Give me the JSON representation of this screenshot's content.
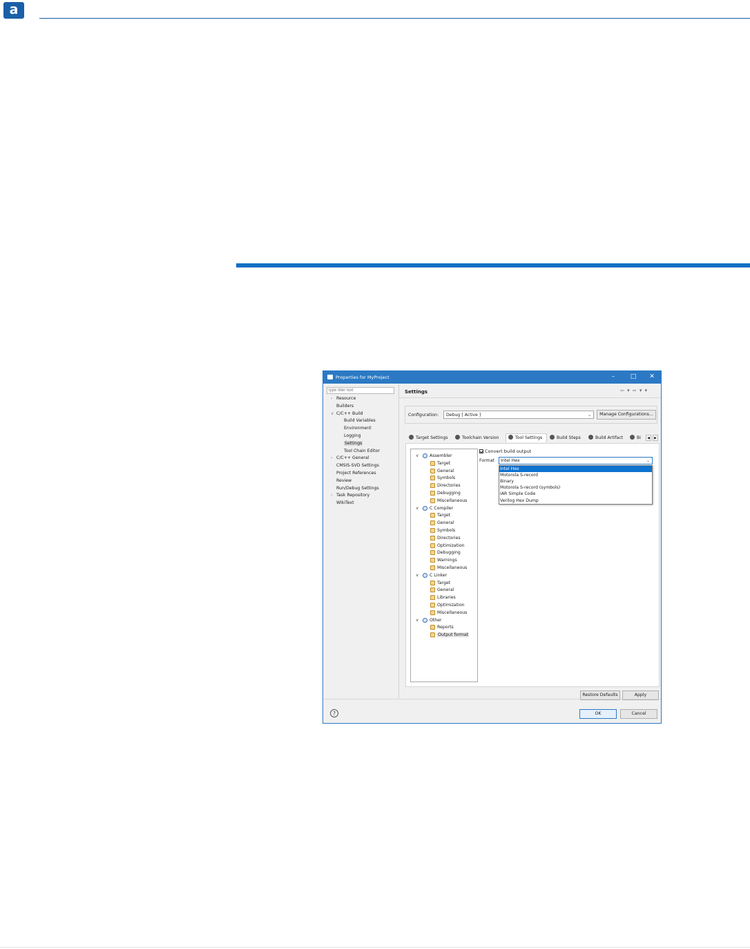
{
  "page": {
    "logo_letter": "a"
  },
  "dialog": {
    "title": "Properties for MyProject",
    "filter_placeholder": "type filter text",
    "nav": [
      {
        "label": "Resource",
        "indent": 0,
        "arrow": ">"
      },
      {
        "label": "Builders",
        "indent": 0,
        "arrow": ""
      },
      {
        "label": "C/C++ Build",
        "indent": 0,
        "arrow": "v"
      },
      {
        "label": "Build Variables",
        "indent": 1,
        "arrow": ""
      },
      {
        "label": "Environment",
        "indent": 1,
        "arrow": ""
      },
      {
        "label": "Logging",
        "indent": 1,
        "arrow": ""
      },
      {
        "label": "Settings",
        "indent": 1,
        "arrow": "",
        "selected": true
      },
      {
        "label": "Tool Chain Editor",
        "indent": 1,
        "arrow": ""
      },
      {
        "label": "C/C++ General",
        "indent": 0,
        "arrow": ">"
      },
      {
        "label": "CMSIS-SVD Settings",
        "indent": 0,
        "arrow": ""
      },
      {
        "label": "Project References",
        "indent": 0,
        "arrow": ""
      },
      {
        "label": "Review",
        "indent": 0,
        "arrow": ""
      },
      {
        "label": "Run/Debug Settings",
        "indent": 0,
        "arrow": ""
      },
      {
        "label": "Task Repository",
        "indent": 0,
        "arrow": ">"
      },
      {
        "label": "WikiText",
        "indent": 0,
        "arrow": ""
      }
    ],
    "settings_heading": "Settings",
    "configuration_label": "Configuration:",
    "configuration_value": "Debug  [ Active ]",
    "manage_button": "Manage Configurations...",
    "tabs": [
      {
        "label": "Target Settings"
      },
      {
        "label": "Toolchain Version"
      },
      {
        "label": "Tool Settings",
        "active": true
      },
      {
        "label": "Build Steps"
      },
      {
        "label": "Build Artifact"
      },
      {
        "label": "Bi"
      }
    ],
    "tree": [
      {
        "label": "Assembler",
        "level": 0
      },
      {
        "label": "Target",
        "level": 1
      },
      {
        "label": "General",
        "level": 1
      },
      {
        "label": "Symbols",
        "level": 1
      },
      {
        "label": "Directories",
        "level": 1
      },
      {
        "label": "Debugging",
        "level": 1
      },
      {
        "label": "Miscellaneous",
        "level": 1
      },
      {
        "label": "C Compiler",
        "level": 0
      },
      {
        "label": "Target",
        "level": 1
      },
      {
        "label": "General",
        "level": 1
      },
      {
        "label": "Symbols",
        "level": 1
      },
      {
        "label": "Directories",
        "level": 1
      },
      {
        "label": "Optimization",
        "level": 1
      },
      {
        "label": "Debugging",
        "level": 1
      },
      {
        "label": "Warnings",
        "level": 1
      },
      {
        "label": "Miscellaneous",
        "level": 1
      },
      {
        "label": "C Linker",
        "level": 0
      },
      {
        "label": "Target",
        "level": 1
      },
      {
        "label": "General",
        "level": 1
      },
      {
        "label": "Libraries",
        "level": 1
      },
      {
        "label": "Optimization",
        "level": 1
      },
      {
        "label": "Miscellaneous",
        "level": 1
      },
      {
        "label": "Other",
        "level": 0
      },
      {
        "label": "Reports",
        "level": 1
      },
      {
        "label": "Output format",
        "level": 1,
        "selected": true
      }
    ],
    "convert_label": "Convert build output",
    "format_label": "Format",
    "format_value": "Intel Hex",
    "format_options": [
      {
        "label": "Intel Hex",
        "selected": true
      },
      {
        "label": "Motorola S-record"
      },
      {
        "label": "Binary"
      },
      {
        "label": "Motorola S-record (symbols)"
      },
      {
        "label": "IAR Simple Code"
      },
      {
        "label": "Verilog Hex Dump"
      }
    ],
    "restore_defaults": "Restore Defaults",
    "apply": "Apply",
    "ok": "OK",
    "cancel": "Cancel",
    "help_glyph": "?"
  },
  "colors": {
    "accent": "#2b79c4",
    "selection": "#0e72cf",
    "brand": "#1a5fa8"
  }
}
